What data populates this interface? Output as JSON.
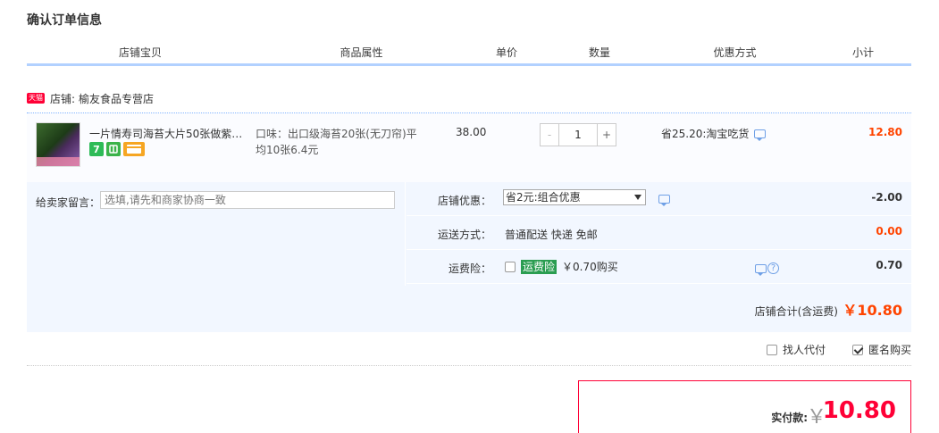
{
  "page_title": "确认订单信息",
  "table_header": {
    "cols": [
      "店铺宝贝",
      "商品属性",
      "单价",
      "数量",
      "优惠方式",
      "小计"
    ]
  },
  "shop": {
    "badge": "天猫",
    "label": "店铺:",
    "name": "榆友食品专营店"
  },
  "item": {
    "title": "一片情寿司海苔大片50张做紫菜包饭",
    "attr": "口味：出口级海苔20张(无刀帘)平均10张6.4元",
    "price": "38.00",
    "qty_minus": "-",
    "qty": "1",
    "qty_plus": "+",
    "discount": "省25.20:淘宝吃货",
    "subtotal": "12.80",
    "icon7": "7"
  },
  "memo": {
    "label": "给卖家留言：",
    "placeholder": "选填,请先和商家协商一致"
  },
  "shop_discount": {
    "label": "店铺优惠：",
    "selected": "省2元:组合优惠",
    "amount": "-2.00"
  },
  "shipping": {
    "label": "运送方式：",
    "value": "普通配送 快递 免邮",
    "amount": "0.00"
  },
  "insurance": {
    "label": "运费险：",
    "badge": "运费险",
    "value": "￥0.70购买",
    "amount": "0.70"
  },
  "shop_total": {
    "label": "店铺合计(含运费)",
    "amount": "￥10.80"
  },
  "extra_options": {
    "proxy_pay": "找人代付",
    "anonymous": "匿名购买"
  },
  "payment": {
    "label": "实付款:",
    "yen": "￥",
    "amount": "10.80"
  },
  "icons": {
    "help": "?"
  }
}
